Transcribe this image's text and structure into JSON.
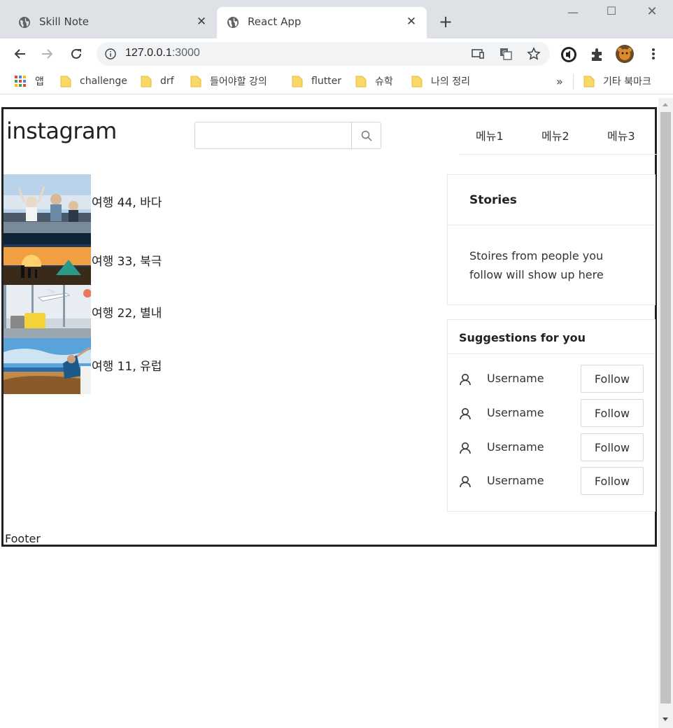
{
  "browser": {
    "tabs": [
      {
        "title": "Skill Note",
        "active": false
      },
      {
        "title": "React App",
        "active": true
      }
    ],
    "new_tab": "+",
    "url": {
      "host": "127.0.0.1",
      "port": ":3000"
    },
    "bookmarks": [
      {
        "label": "앱",
        "icon": "apps-grid-icon"
      },
      {
        "label": "challenge",
        "icon": "folder-icon"
      },
      {
        "label": "drf",
        "icon": "folder-icon"
      },
      {
        "label": "들어야할 강의",
        "icon": "folder-icon"
      },
      {
        "label": "flutter",
        "icon": "folder-icon"
      },
      {
        "label": "슈학",
        "icon": "folder-icon"
      },
      {
        "label": "나의 정리",
        "icon": "folder-icon"
      }
    ],
    "bookmarks_overflow": "»",
    "other_bookmarks": "기타 북마크"
  },
  "app": {
    "logo": "instagram",
    "search": {
      "placeholder": ""
    },
    "menu": [
      "메뉴1",
      "메뉴2",
      "메뉴3"
    ],
    "posts": [
      {
        "caption": "여행 44, 바다",
        "image": "friends-in-convertible"
      },
      {
        "caption": "여행 33, 북극",
        "image": "camping-sunset"
      },
      {
        "caption": "여행 22, 별내",
        "image": "airport-luggage"
      },
      {
        "caption": "여행 11, 유럽",
        "image": "car-window-coast"
      }
    ],
    "stories": {
      "title": "Stories",
      "body": "Stoires from people you follow will show up here"
    },
    "suggestions": {
      "title": "Suggestions for you",
      "users": [
        {
          "username": "Username",
          "action": "Follow"
        },
        {
          "username": "Username",
          "action": "Follow"
        },
        {
          "username": "Username",
          "action": "Follow"
        },
        {
          "username": "Username",
          "action": "Follow"
        }
      ]
    },
    "footer": "Footer"
  },
  "colors": {
    "tabstrip": "#dee1e6",
    "frame_border": "#222222",
    "card_border": "#e8e8e8"
  }
}
